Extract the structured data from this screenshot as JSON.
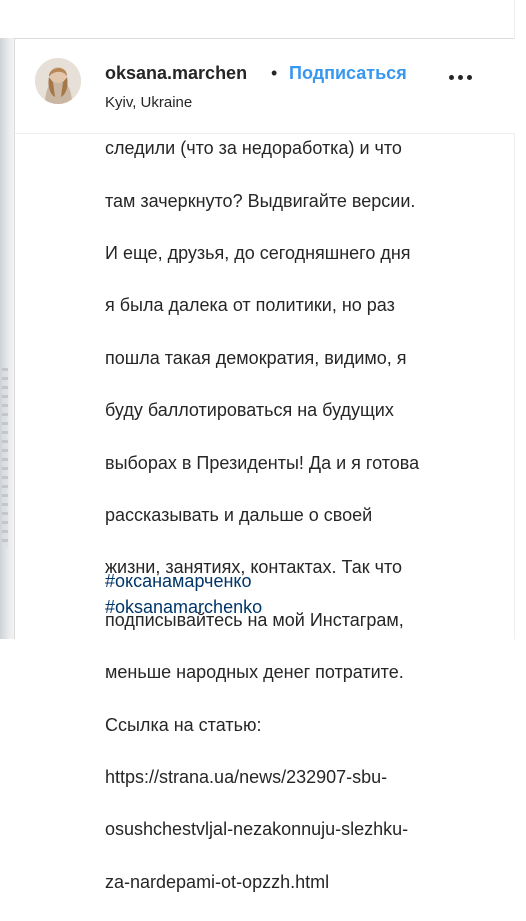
{
  "post": {
    "username": "oksana.marchen",
    "separator": "•",
    "follow_label": "Подписаться",
    "location": "Kyiv, Ukraine",
    "more_icon": "more-horizontal-icon",
    "caption_partial_top": "следили (что за недоработка) и что",
    "caption_lines": [
      "следили (что за недоработка) и что",
      "там зачеркнуто? Выдвигайте версии.",
      "И еще, друзья, до сегодняшнего дня",
      "я была далека от политики, но раз",
      "пошла такая демократия, видимо, я",
      "буду баллотироваться на будущих",
      "выборах в Президенты! Да и я готова",
      "рассказывать и дальше о своей",
      "жизни, занятиях, контактах. Так что",
      "подписывайтесь на мой Инстаграм,",
      "меньше народных денег потратите.",
      "Ссылка на статью:",
      "https://strana.ua/news/232907-sbu-",
      "osushchestvljal-nezakonnuju-slezhku-",
      "za-nardepami-ot-opzzh.html"
    ],
    "hashtags": [
      "#оксанамарченко",
      "#oksanamarchenko"
    ]
  }
}
